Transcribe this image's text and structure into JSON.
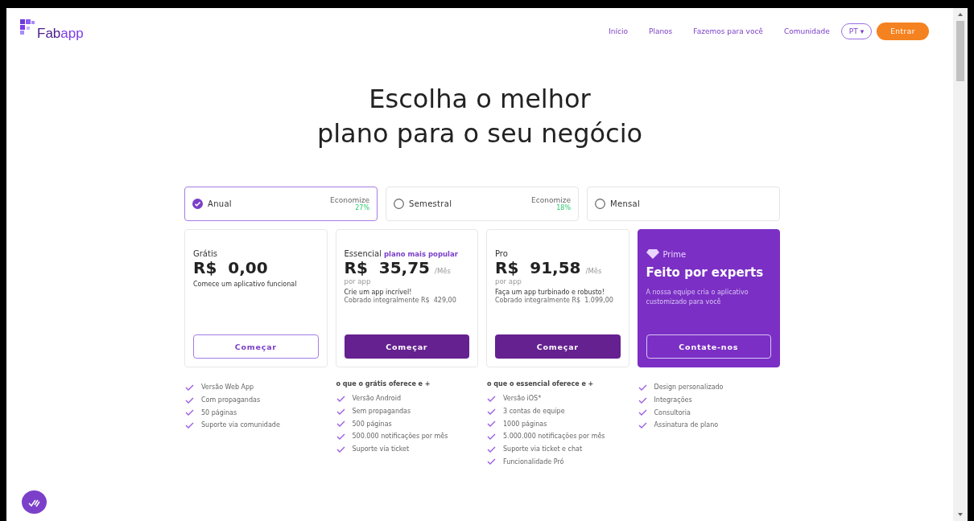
{
  "header": {
    "logo": {
      "part1": "Fab",
      "part2": "app"
    },
    "nav": [
      "Início",
      "Planos",
      "Fazemos para você",
      "Comunidade"
    ],
    "language": {
      "label": "PT",
      "caret": "▾"
    },
    "login": "Entrar"
  },
  "hero": {
    "title_lines": [
      "Escolha o melhor",
      "plano para o seu negócio"
    ]
  },
  "billing": [
    {
      "label": "Anual",
      "selected": true,
      "save_label": "Economize",
      "save_value": "27%"
    },
    {
      "label": "Semestral",
      "selected": false,
      "save_label": "Economize",
      "save_value": "18%"
    },
    {
      "label": "Mensal",
      "selected": false
    }
  ],
  "plans": [
    {
      "kind": "outline",
      "name": "Grátis",
      "price": "R$  0,00",
      "description": "Comece um aplicativo funcional",
      "button": "Começar",
      "features": [
        "Versão Web App",
        "Com propagandas",
        "50 páginas",
        "Suporte via comunidade"
      ]
    },
    {
      "kind": "filled",
      "name": "Essencial",
      "badge": "plano mais popular",
      "price": "R$  35,75",
      "period": "/Mês",
      "per": "por app",
      "description": "Crie um app incrível!",
      "billed": "Cobrado integralmente R$  429,00",
      "button": "Começar",
      "features_header": "o que o grátis oferece e +",
      "features": [
        "Versão Android",
        "Sem propagandas",
        "500 páginas",
        "500.000 notificações por mês",
        "Suporte via ticket"
      ]
    },
    {
      "kind": "filled",
      "name": "Pro",
      "price": "R$  91,58",
      "period": "/Mês",
      "per": "por app",
      "description": "Faça um app turbinado e robusto!",
      "billed": "Cobrado integralmente R$  1.099,00",
      "button": "Começar",
      "features_header": "o que o essencial oferece e +",
      "features": [
        "Versão iOS*",
        "3 contas de equipe",
        "1000 páginas",
        "5.000.000 notificações por mês",
        "Suporte via ticket e chat",
        "Funcionalidade Pró"
      ]
    },
    {
      "kind": "prime",
      "name": "Prime",
      "headline": "Feito por experts",
      "description": "A nossa equipe cria o aplicativo customizado para você",
      "button": "Contate-nos",
      "features": [
        "Design personalizado",
        "Integrações",
        "Consultoria",
        "Assinatura de plano"
      ]
    }
  ]
}
